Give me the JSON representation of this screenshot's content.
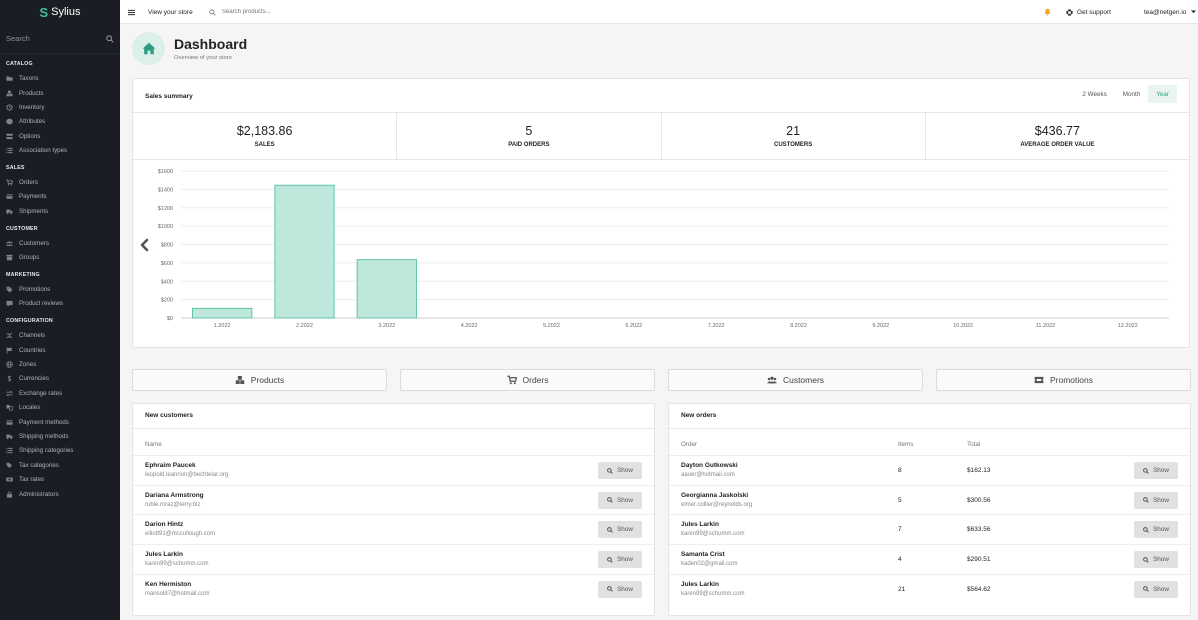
{
  "brand": {
    "name": "Sylius",
    "accent": "#3fbf9f"
  },
  "sidebar": {
    "search_label": "Search",
    "sections": [
      {
        "title": "CATALOG",
        "items": [
          {
            "label": "Taxons",
            "icon": "folder-icon"
          },
          {
            "label": "Products",
            "icon": "cubes-icon"
          },
          {
            "label": "Inventory",
            "icon": "history-icon"
          },
          {
            "label": "Attributes",
            "icon": "cube-icon"
          },
          {
            "label": "Options",
            "icon": "options-icon"
          },
          {
            "label": "Association types",
            "icon": "list-icon"
          }
        ]
      },
      {
        "title": "SALES",
        "items": [
          {
            "label": "Orders",
            "icon": "cart-icon"
          },
          {
            "label": "Payments",
            "icon": "payment-icon"
          },
          {
            "label": "Shipments",
            "icon": "truck-icon"
          }
        ]
      },
      {
        "title": "CUSTOMER",
        "items": [
          {
            "label": "Customers",
            "icon": "users-icon"
          },
          {
            "label": "Groups",
            "icon": "archive-icon"
          }
        ]
      },
      {
        "title": "MARKETING",
        "items": [
          {
            "label": "Promotions",
            "icon": "tag-icon"
          },
          {
            "label": "Product reviews",
            "icon": "comment-icon"
          }
        ]
      },
      {
        "title": "CONFIGURATION",
        "items": [
          {
            "label": "Channels",
            "icon": "shuffle-icon"
          },
          {
            "label": "Countries",
            "icon": "flag-icon"
          },
          {
            "label": "Zones",
            "icon": "globe-icon"
          },
          {
            "label": "Currencies",
            "icon": "dollar-icon"
          },
          {
            "label": "Exchange rates",
            "icon": "exchange-icon"
          },
          {
            "label": "Locales",
            "icon": "translate-icon"
          },
          {
            "label": "Payment methods",
            "icon": "payment-icon"
          },
          {
            "label": "Shipping methods",
            "icon": "truck-icon"
          },
          {
            "label": "Shipping categories",
            "icon": "list-icon"
          },
          {
            "label": "Tax categories",
            "icon": "tags-icon"
          },
          {
            "label": "Tax rates",
            "icon": "money-icon"
          },
          {
            "label": "Administrators",
            "icon": "lock-icon"
          }
        ]
      }
    ]
  },
  "topbar": {
    "view_store": "View your store",
    "search_placeholder": "Search products...",
    "support": "Get support",
    "user": "tea@netgen.io"
  },
  "header": {
    "title": "Dashboard",
    "subtitle": "Overview of your store"
  },
  "sales_summary": {
    "title": "Sales summary",
    "ranges": [
      "2 Weeks",
      "Month",
      "Year"
    ],
    "active_range": "Year",
    "stats": [
      {
        "value": "$2,183.86",
        "label": "SALES"
      },
      {
        "value": "5",
        "label": "PAID ORDERS"
      },
      {
        "value": "21",
        "label": "CUSTOMERS"
      },
      {
        "value": "$436.77",
        "label": "AVERAGE ORDER VALUE"
      }
    ]
  },
  "chart_data": {
    "type": "bar",
    "categories": [
      "1.2022",
      "2.2022",
      "3.2022",
      "4.2022",
      "5.2022",
      "6.2022",
      "7.2022",
      "8.2022",
      "9.2022",
      "10.2022",
      "11.2022",
      "12.2022"
    ],
    "values": [
      105,
      1445,
      635,
      0,
      0,
      0,
      0,
      0,
      0,
      0,
      0,
      0
    ],
    "yticks": [
      "$0",
      "$200",
      "$400",
      "$600",
      "$800",
      "$1000",
      "$1200",
      "$1400",
      "$1600"
    ],
    "ylim": [
      0,
      1600
    ],
    "grid": true,
    "bar_color": "#bfe8dd",
    "bar_stroke": "#5fc4a9"
  },
  "nav_buttons": [
    {
      "label": "Products",
      "icon": "cubes-icon"
    },
    {
      "label": "Orders",
      "icon": "cart-icon"
    },
    {
      "label": "Customers",
      "icon": "users-icon"
    },
    {
      "label": "Promotions",
      "icon": "ticket-icon"
    }
  ],
  "new_customers": {
    "title": "New customers",
    "column": "Name",
    "show_label": "Show",
    "rows": [
      {
        "name": "Ephraim Paucek",
        "email": "leopold.leannon@bechtelar.org"
      },
      {
        "name": "Dariana Armstrong",
        "email": "rubie.mraz@terry.biz"
      },
      {
        "name": "Darion Hintz",
        "email": "elliott91@mccullough.com"
      },
      {
        "name": "Jules Larkin",
        "email": "karen99@schumm.com"
      },
      {
        "name": "Ken Hermiston",
        "email": "marisol87@hotmail.com"
      }
    ]
  },
  "new_orders": {
    "title": "New orders",
    "columns": [
      "Order",
      "Items",
      "Total"
    ],
    "show_label": "Show",
    "rows": [
      {
        "name": "Dayton Gutkowski",
        "email": "aauer@hotmail.com",
        "items": "8",
        "total": "$162.13"
      },
      {
        "name": "Georgianna Jaskolski",
        "email": "elmer.collier@reynolds.org",
        "items": "5",
        "total": "$300.56"
      },
      {
        "name": "Jules Larkin",
        "email": "karen99@schumm.com",
        "items": "7",
        "total": "$633.56"
      },
      {
        "name": "Samanta Crist",
        "email": "kaden02@gmail.com",
        "items": "4",
        "total": "$290.51"
      },
      {
        "name": "Jules Larkin",
        "email": "karen99@schumm.com",
        "items": "21",
        "total": "$564.62"
      }
    ]
  }
}
